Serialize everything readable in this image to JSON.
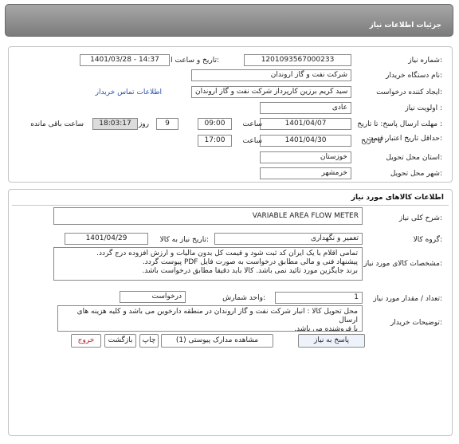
{
  "title": "جزئیات اطلاعات نیاز",
  "info": {
    "need_number_label": "شماره نیاز:",
    "need_number": "1201093567000233",
    "announce_datetime_label": "تاریخ و ساعت اعلان عمومی:",
    "announce_datetime": "1401/03/28 - 14:37",
    "buyer_org_label": "نام دستگاه خریدار:",
    "buyer_org": "شرکت نفت و گاز اروندان",
    "creator_label": "ایجاد کننده درخواست:",
    "creator": "سید کریم برزین کارپرداز شرکت نفت و گاز اروندان",
    "contact_link": "اطلاعات تماس خریدار",
    "priority_label": "اولویت نیاز :",
    "priority": "عادی",
    "reply_deadline_label": "مهلت ارسال پاسخ: تا تاریخ :",
    "reply_date": "1401/04/07",
    "reply_time_label": "ساعت",
    "reply_time": "09:00",
    "days": "9",
    "days_label": "روز و",
    "remaining_time": "18:03:17",
    "remaining_label": "ساعت باقی مانده",
    "validity_label": "حداقل تاریخ اعتبار قیمت:",
    "validity_to_label": "تا تاریخ :",
    "validity_date": "1401/04/30",
    "validity_time_label": "ساعت",
    "validity_time": "17:00",
    "province_label": "استان محل تحویل:",
    "province": "خوزستان",
    "city_label": "شهر محل تحویل:",
    "city": "خرمشهر"
  },
  "goods": {
    "header": "اطلاعات کالاهای مورد نیاز",
    "summary_label": "شرح کلی نیاز:",
    "summary": "VARIABLE AREA FLOW METER",
    "group_label": "گروه کالا:",
    "group": "تعمیر و نگهداری",
    "need_date_label": "تاریخ نیاز به کالا:",
    "need_date": "1401/04/29",
    "spec_label": "مشخصات کالای مورد نیاز:",
    "spec_lines": [
      "تمامی اقلام با یک ایران کد ثبت شود و قیمت کل بدون مالیات و ارزش افزوده درج گردد.",
      "پیشنهاد فنی و مالی مطابق درخواست به صورت فایل PDF پیوست گردد.",
      "برند جایگزین مورد تائید نمی باشد. کالا باید دقیقا مطابق درخواست باشد."
    ],
    "qty_label": "تعداد / مقدار مورد نیاز:",
    "qty": "1",
    "unit_label": "واحد شمارش:",
    "unit": "درخواست",
    "buyer_notes_label": "توضیحات خریدار:",
    "buyer_notes_lines": [
      "محل تحویل کالا : انبار شرکت نفت و گاز اروندان در منطقه دارخوین می باشد و کلیه هزینه های ارسال",
      "با فروشنده می باشد."
    ]
  },
  "buttons": {
    "reply": "پاسخ به نیاز",
    "attachments": "مشاهده مدارک پیوستی (1)",
    "print": "چاپ",
    "back": "بازگشت",
    "exit": "خروج"
  }
}
